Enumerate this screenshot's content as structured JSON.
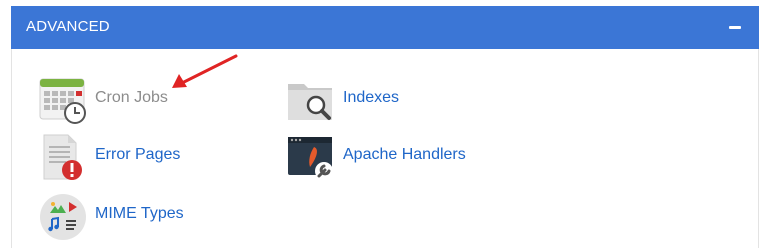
{
  "section": {
    "title": "ADVANCED"
  },
  "items": [
    {
      "label": "Cron Jobs",
      "icon": "calendar-clock-icon"
    },
    {
      "label": "Indexes",
      "icon": "folder-search-icon"
    },
    {
      "label": "Error Pages",
      "icon": "error-document-icon"
    },
    {
      "label": "Apache Handlers",
      "icon": "terminal-wrench-icon"
    },
    {
      "label": "MIME Types",
      "icon": "media-types-icon"
    }
  ],
  "colors": {
    "header": "#3b76d6",
    "link": "#1f66c8",
    "visited": "#8c8c8c",
    "annotation_arrow": "#e02424"
  }
}
